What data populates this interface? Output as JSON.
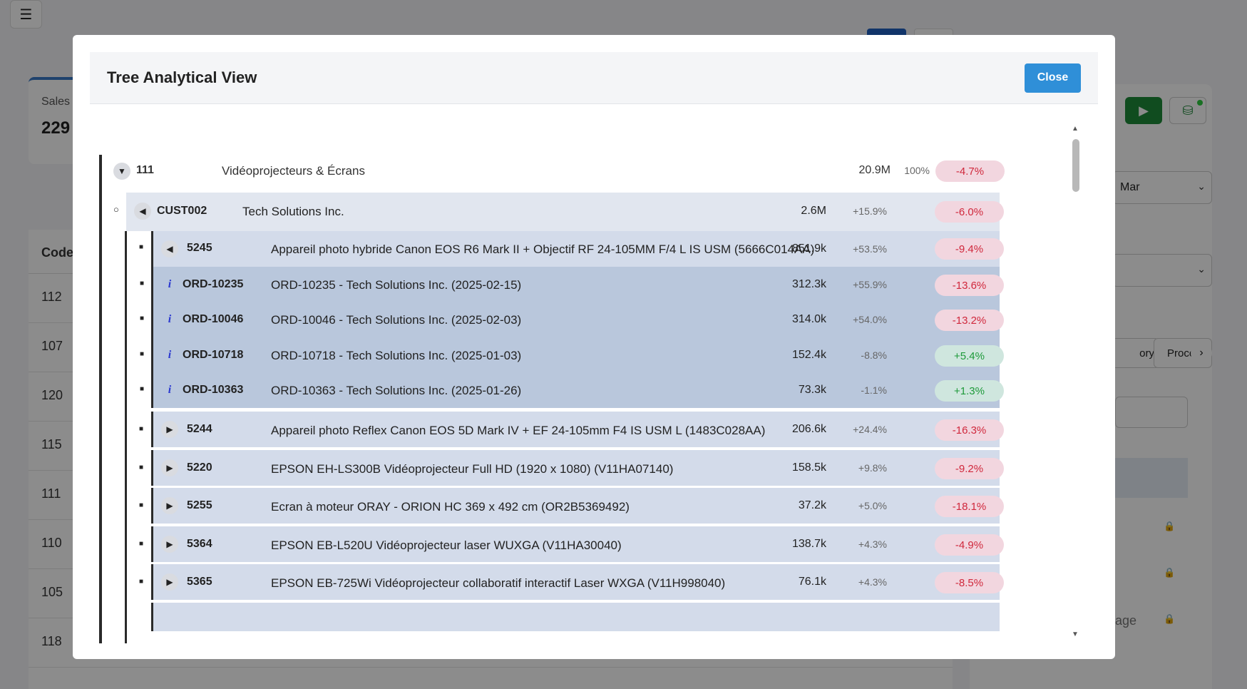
{
  "background": {
    "kpi": {
      "label": "Sales",
      "value": "229"
    },
    "table_header": "Code",
    "table_codes": [
      "112",
      "107",
      "120",
      "115",
      "111",
      "110",
      "105",
      "118"
    ],
    "select1_value": "Mar",
    "tab_a_label": "ory",
    "tab_b_label": "Proce",
    "sage_text": "age"
  },
  "modal": {
    "title": "Tree Analytical View",
    "close_label": "Close"
  },
  "tree": {
    "root": {
      "code": "111",
      "name": "Vidéoprojecteurs & Écrans",
      "value": "20.9M",
      "pct": "100%",
      "delta": "-4.7%",
      "toggle": "▼"
    },
    "customer": {
      "code": "CUST002",
      "name": "Tech Solutions Inc.",
      "value": "2.6M",
      "pct": "+15.9%",
      "delta": "-6.0%",
      "toggle": "◀",
      "bullet": "○"
    },
    "products": [
      {
        "code": "5245",
        "name": "Appareil photo hybride Canon EOS R6 Mark II + Objectif RF 24-105MM F/4 L IS USM (5666C014AA)",
        "value": "851.9k",
        "pct": "+53.5%",
        "delta": "-9.4%",
        "toggle": "◀",
        "status": "neg"
      },
      {
        "code": "5244",
        "name": "Appareil photo Reflex Canon EOS 5D Mark IV + EF 24-105mm F4 IS USM L (1483C028AA)",
        "value": "206.6k",
        "pct": "+24.4%",
        "delta": "-16.3%",
        "toggle": "▶",
        "status": "neg"
      },
      {
        "code": "5220",
        "name": "EPSON EH-LS300B Vidéoprojecteur Full HD (1920 x 1080) (V11HA07140)",
        "value": "158.5k",
        "pct": "+9.8%",
        "delta": "-9.2%",
        "toggle": "▶",
        "status": "neg"
      },
      {
        "code": "5255",
        "name": "Ecran à moteur ORAY - ORION HC 369 x 492 cm (OR2B5369492)",
        "value": "37.2k",
        "pct": "+5.0%",
        "delta": "-18.1%",
        "toggle": "▶",
        "status": "neg"
      },
      {
        "code": "5364",
        "name": "EPSON EB-L520U Vidéoprojecteur laser WUXGA (V11HA30040)",
        "value": "138.7k",
        "pct": "+4.3%",
        "delta": "-4.9%",
        "toggle": "▶",
        "status": "neg"
      },
      {
        "code": "5365",
        "name": "EPSON EB-725Wi Vidéoprojecteur collaboratif interactif Laser WXGA (V11H998040)",
        "value": "76.1k",
        "pct": "+4.3%",
        "delta": "-8.5%",
        "toggle": "▶",
        "status": "neg"
      }
    ],
    "orders": [
      {
        "code": "ORD-10235",
        "name": "ORD-10235 - Tech Solutions Inc. (2025-02-15)",
        "value": "312.3k",
        "pct": "+55.9%",
        "delta": "-13.6%",
        "status": "neg"
      },
      {
        "code": "ORD-10046",
        "name": "ORD-10046 - Tech Solutions Inc. (2025-02-03)",
        "value": "314.0k",
        "pct": "+54.0%",
        "delta": "-13.2%",
        "status": "neg"
      },
      {
        "code": "ORD-10718",
        "name": "ORD-10718 - Tech Solutions Inc. (2025-01-03)",
        "value": "152.4k",
        "pct": "-8.8%",
        "delta": "+5.4%",
        "status": "pos"
      },
      {
        "code": "ORD-10363",
        "name": "ORD-10363 - Tech Solutions Inc. (2025-01-26)",
        "value": "73.3k",
        "pct": "-1.1%",
        "delta": "+1.3%",
        "status": "pos"
      }
    ],
    "bullet_char": "■",
    "info_char": "i"
  }
}
